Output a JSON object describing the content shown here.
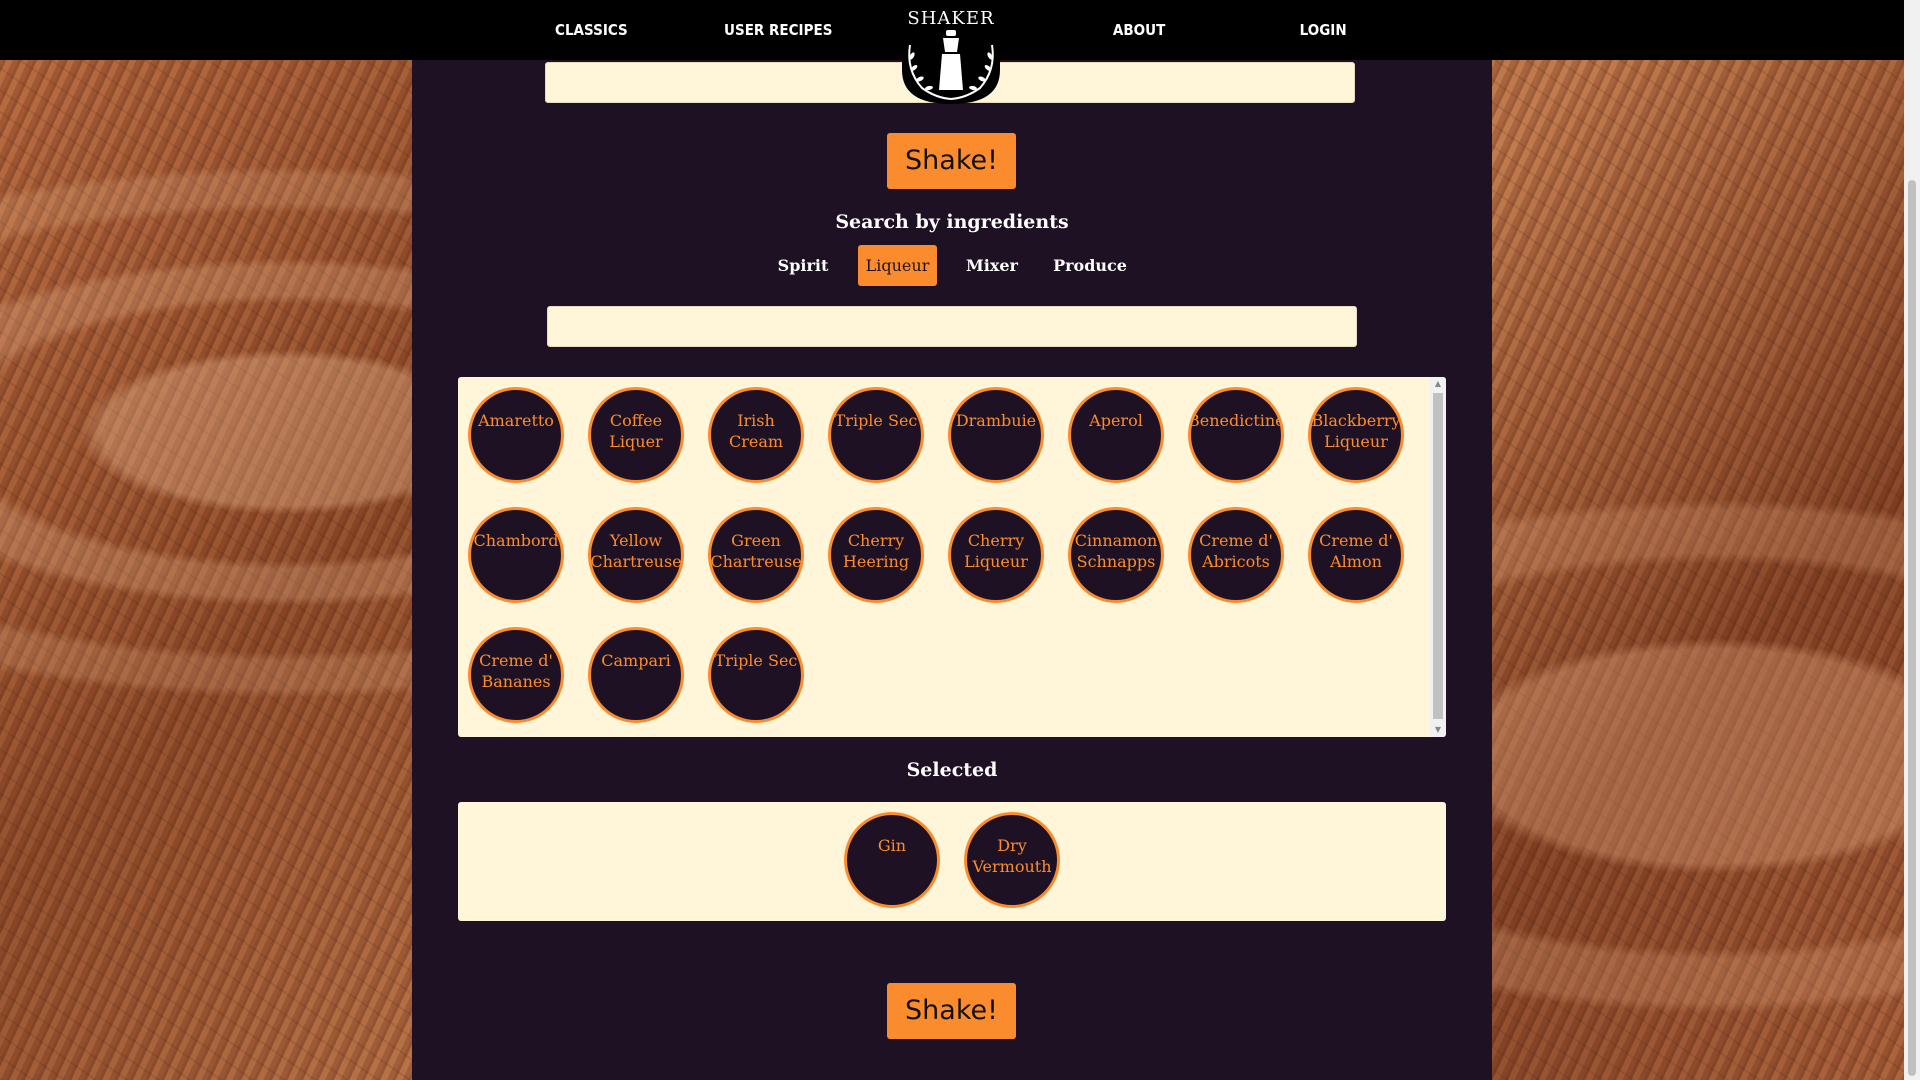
{
  "nav": {
    "links": [
      "CLASSICS",
      "USER RECIPES",
      "ABOUT",
      "LOGIN"
    ],
    "logo_text": "SHAKER"
  },
  "search": {
    "top_value": "",
    "ingredient_value": ""
  },
  "shake_label": "Shake!",
  "search_heading": "Search by ingredients",
  "tabs": [
    {
      "label": "Spirit",
      "active": false
    },
    {
      "label": "Liqueur",
      "active": true
    },
    {
      "label": "Mixer",
      "active": false
    },
    {
      "label": "Produce",
      "active": false
    }
  ],
  "ingredients": [
    "Amaretto",
    "Coffee Liquer",
    "Irish Cream",
    "Triple Sec",
    "Drambuie",
    "Aperol",
    "Benedictine",
    "Blackberry Liqueur",
    "Chambord",
    "Yellow Chartreuse",
    "Green Chartreuse",
    "Cherry Heering",
    "Cherry Liqueur",
    "Cinnamon Schnapps",
    "Creme d' Abricots",
    "Creme d' Almon",
    "Creme d' Bananes",
    "Campari",
    "Triple Sec"
  ],
  "selected_heading": "Selected",
  "selected": [
    "Gin",
    "Dry Vermouth"
  ],
  "colors": {
    "accent": "#fb8c2e",
    "panel": "#1f1124",
    "box": "#fff6da",
    "navbar": "#000000"
  }
}
